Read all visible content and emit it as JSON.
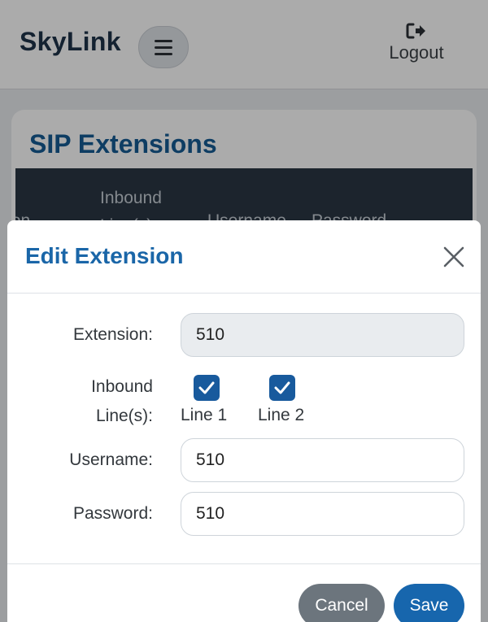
{
  "app": {
    "brand": "SkyLink",
    "logout_label": "Logout"
  },
  "page": {
    "title": "SIP Extensions",
    "table_headers": [
      "nsion",
      "Inbound\nLine(s)",
      "Username",
      "Password"
    ]
  },
  "modal": {
    "title": "Edit Extension",
    "fields": {
      "extension": {
        "label": "Extension:",
        "value": "510"
      },
      "inbound": {
        "label": "Inbound\nLine(s):",
        "lines": [
          {
            "label": "Line 1",
            "checked": true
          },
          {
            "label": "Line 2",
            "checked": true
          }
        ]
      },
      "username": {
        "label": "Username:",
        "value": "510"
      },
      "password": {
        "label": "Password:",
        "value": "510"
      }
    },
    "buttons": {
      "cancel": "Cancel",
      "save": "Save"
    }
  },
  "colors": {
    "brand": "#1f3349",
    "title_blue": "#1a66a8",
    "checkbox": "#185a9d",
    "save": "#1766ad",
    "cancel": "#6c757d",
    "table_header_bg": "#2a3744"
  },
  "icons": {
    "menu": "hamburger-icon",
    "logout": "logout-icon",
    "close": "close-icon",
    "check": "checkmark-icon"
  }
}
